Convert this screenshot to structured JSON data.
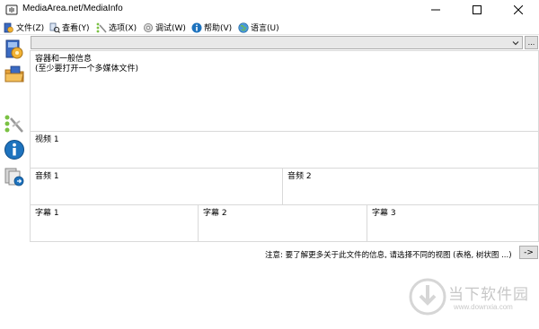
{
  "window": {
    "title": "MediaArea.net/MediaInfo"
  },
  "menu": [
    {
      "label": "文件(Z)",
      "icon": "file-icon"
    },
    {
      "label": "查看(Y)",
      "icon": "view-icon"
    },
    {
      "label": "选项(X)",
      "icon": "options-icon"
    },
    {
      "label": "调试(W)",
      "icon": "debug-icon"
    },
    {
      "label": "帮助(V)",
      "icon": "help-icon"
    },
    {
      "label": "语言(U)",
      "icon": "language-icon"
    }
  ],
  "toolbar": {
    "items": [
      "open-file-icon",
      "open-folder-icon",
      "options-tool-icon",
      "about-info-icon",
      "export-icon"
    ]
  },
  "file_selector": {
    "value": "",
    "more_label": "..."
  },
  "sections": {
    "general": {
      "title": "容器和一般信息",
      "subtitle": "(至少要打开一个多媒体文件)"
    },
    "video1": {
      "title": "视频 1"
    },
    "audio1": {
      "title": "音频 1"
    },
    "audio2": {
      "title": "音频 2"
    },
    "text1": {
      "title": "字幕 1"
    },
    "text2": {
      "title": "字幕 2"
    },
    "text3": {
      "title": "字幕 3"
    }
  },
  "footer": {
    "note": "注意: 要了解更多关于此文件的信息, 请选择不同的视图 (表格, 树状图 ...)",
    "next_label": "->"
  },
  "watermark": {
    "name": "当下软件园",
    "url": "www.downxia.com"
  },
  "colors": {
    "accent": "#1e73be",
    "border": "#d9d9d9",
    "combo_bg": "#e8e8e8"
  }
}
